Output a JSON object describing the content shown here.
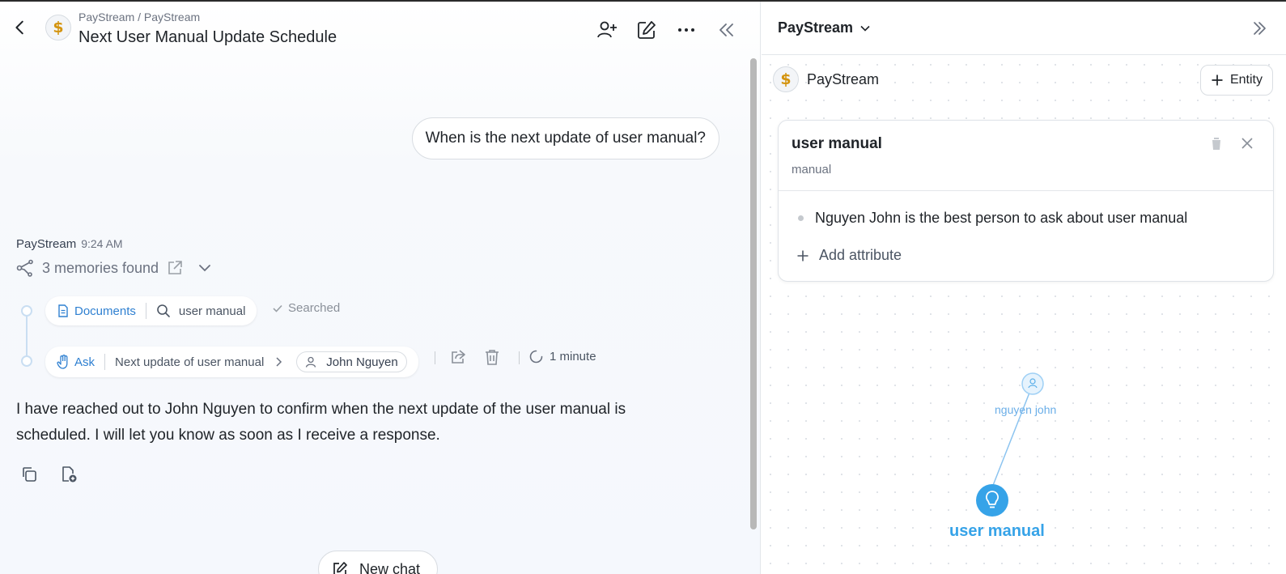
{
  "header": {
    "breadcrumb": "PayStream / PayStream",
    "title": "Next User Manual Update Schedule",
    "avatar_glyph": "$"
  },
  "chat": {
    "user_message": "When is the next update of user manual?",
    "sender": "PayStream",
    "time": "9:24 AM",
    "memories_label": "3 memories found",
    "step1": {
      "source": "Documents",
      "query": "user manual",
      "status": "Searched"
    },
    "step2": {
      "action": "Ask",
      "topic": "Next update of user manual",
      "person": "John Nguyen",
      "duration": "1 minute"
    },
    "answer": "I have reached out to John Nguyen to confirm when the next update of the user manual is scheduled. I will let you know as soon as I receive a response.",
    "new_chat_label": "New chat"
  },
  "right_panel": {
    "workspace_select": "PayStream",
    "workspace_name": "PayStream",
    "entity_button": "Entity",
    "card": {
      "title": "user manual",
      "type": "manual",
      "attributes": [
        "Nguyen John is the best person to ask about user manual"
      ],
      "add_attribute_label": "Add attribute"
    },
    "graph": {
      "nodes": [
        {
          "label": "nguyen john",
          "kind": "person"
        },
        {
          "label": "user manual",
          "kind": "idea"
        }
      ]
    }
  },
  "colors": {
    "accent_blue": "#2f80d1",
    "node_blue": "#36a3e8",
    "coin_gold": "#d4940f"
  },
  "icons": [
    "back-icon",
    "add-user-icon",
    "edit-icon",
    "more-icon",
    "collapse-left-icon",
    "share-memory-icon",
    "external-link-icon",
    "chevron-down-icon",
    "document-icon",
    "search-icon",
    "check-icon",
    "hand-icon",
    "chevron-right-icon",
    "person-icon",
    "share-icon",
    "trash-icon",
    "spinner-icon",
    "copy-icon",
    "file-add-icon",
    "new-chat-icon",
    "collapse-right-icon",
    "plus-icon",
    "close-icon",
    "lightbulb-icon"
  ]
}
